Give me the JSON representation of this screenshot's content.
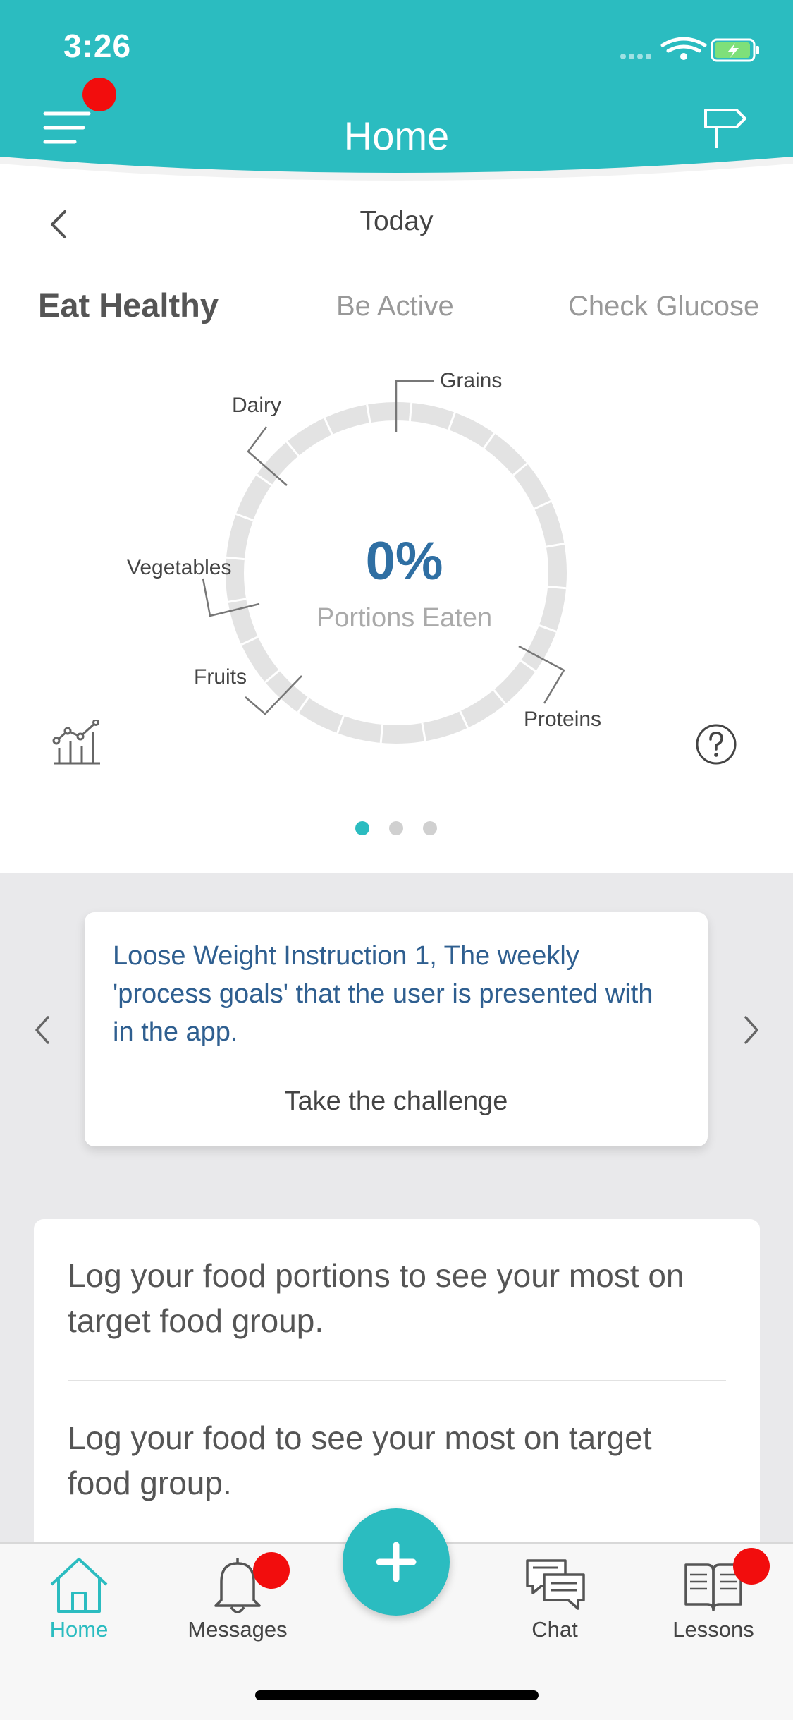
{
  "status_bar": {
    "time": "3:26"
  },
  "header": {
    "title": "Home"
  },
  "date_nav": {
    "label": "Today"
  },
  "tabs": [
    {
      "label": "Eat Healthy",
      "selected": true
    },
    {
      "label": "Be Active",
      "selected": false
    },
    {
      "label": "Check Glucose",
      "selected": false
    }
  ],
  "ring": {
    "percent": "0%",
    "caption": "Portions Eaten",
    "segments": [
      "Grains",
      "Dairy",
      "Vegetables",
      "Fruits",
      "Proteins"
    ],
    "progress": 0
  },
  "pager": {
    "pages": 3,
    "active": 0
  },
  "challenge": {
    "text": "Loose Weight Instruction 1, The weekly 'process goals' that the user is presented with in the app.",
    "cta": "Take the challenge"
  },
  "log_card": {
    "line1": "Log your food portions to see your most on target food group.",
    "line2": "Log your food to see your most on target food group."
  },
  "tabbar": {
    "items": [
      {
        "label": "Home",
        "icon": "house-icon",
        "active": true
      },
      {
        "label": "Messages",
        "icon": "bell-icon",
        "badge": true
      },
      {
        "label": "Chat",
        "icon": "chat-icon"
      },
      {
        "label": "Lessons",
        "icon": "book-icon",
        "badge": true
      }
    ],
    "fab_icon": "plus-icon"
  },
  "colors": {
    "accent": "#2bbcc0",
    "badge": "#f20d0d",
    "link": "#2f6fa3"
  }
}
